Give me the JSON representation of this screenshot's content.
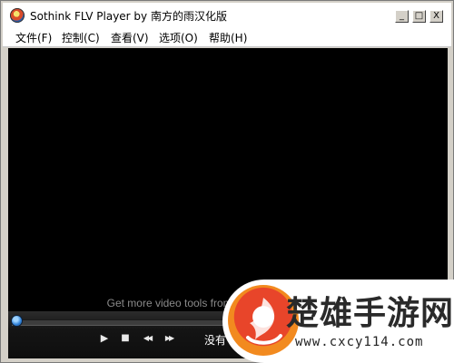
{
  "window": {
    "title": "Sothink FLV Player by 南方的雨汉化版",
    "controls": {
      "minimize": "_",
      "maximize": "□",
      "close": "X"
    }
  },
  "menu": [
    {
      "label": "文件(F)"
    },
    {
      "label": "控制(C)"
    },
    {
      "label": "查看(V)"
    },
    {
      "label": "选项(O)"
    },
    {
      "label": "帮助(H)"
    }
  ],
  "video": {
    "promo_text": "Get more video tools from www.sothinkmedia.com"
  },
  "player": {
    "seek_position": 0,
    "play_glyph": "▶",
    "stop_glyph": "■",
    "rewind_glyph": "◀◀",
    "forward_glyph": "▶▶",
    "status_text": "没有"
  },
  "watermark": {
    "title": "楚雄手游网",
    "url": "www.cxcy114.com",
    "brand_colors": {
      "logo_red": "#e8452a",
      "logo_orange": "#f28a1f"
    }
  }
}
